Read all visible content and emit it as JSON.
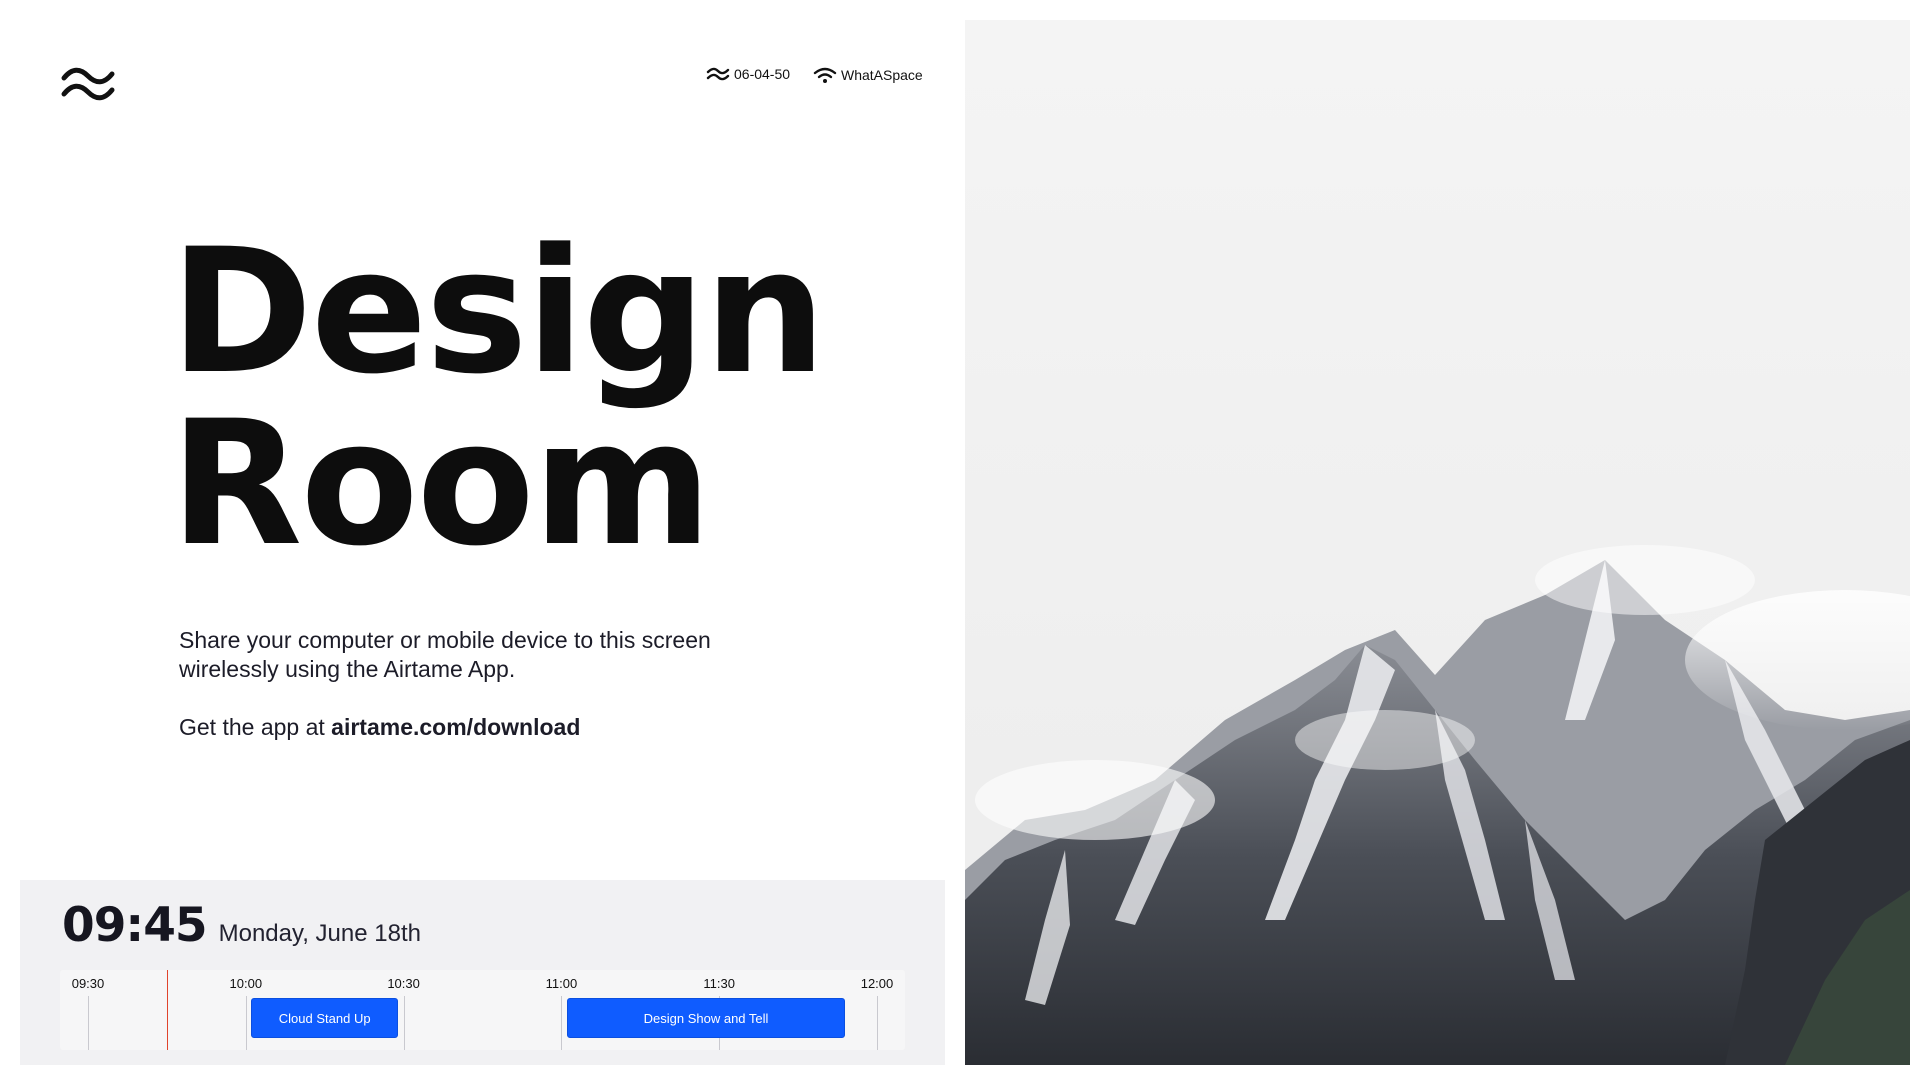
{
  "header": {
    "device_code": "06-04-50",
    "network_name": "WhatASpace"
  },
  "room": {
    "title_line1": "Design",
    "title_line2": "Room"
  },
  "info": {
    "description": "Share your computer or mobile device to this screen wirelessly using the Airtame App.",
    "get_app_prefix": "Get the app at ",
    "download_link": "airtame.com/download"
  },
  "clock": {
    "time": "09:45",
    "date": "Monday, June 18th"
  },
  "timeline": {
    "ticks": [
      "09:30",
      "10:00",
      "10:30",
      "11:00",
      "11:30",
      "12:00"
    ],
    "now": "09:45",
    "events": [
      {
        "title": "Cloud Stand Up",
        "start": "10:01",
        "end": "10:29"
      },
      {
        "title": "Design Show and Tell",
        "start": "11:01",
        "end": "11:54"
      }
    ]
  },
  "colors": {
    "event_blue": "#0f5cff",
    "now_line_red": "#e0442c",
    "schedule_bg": "#f1f1f3"
  },
  "icons": {
    "brand": "airtame-waves-logo",
    "device": "waves-icon",
    "network": "wifi-icon"
  }
}
